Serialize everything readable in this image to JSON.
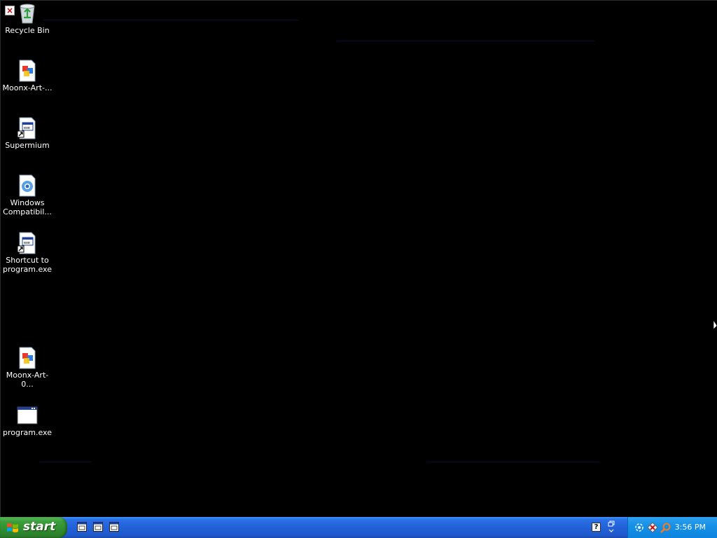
{
  "desktop": {
    "icons": [
      {
        "label": "Recycle Bin",
        "icon": "recycle-bin-icon"
      },
      {
        "label": "Moonx-Art-...",
        "icon": "image-file-icon"
      },
      {
        "label": "Supermium",
        "icon": "program-shortcut-icon"
      },
      {
        "label": "Windows Compatibil...",
        "icon": "compatibility-icon"
      },
      {
        "label": "Shortcut to program.exe",
        "icon": "program-shortcut-icon"
      },
      {
        "label": "Moonx-Art-0...",
        "icon": "image-file-icon"
      },
      {
        "label": "program.exe",
        "icon": "application-window-icon"
      }
    ],
    "error_badge": "×"
  },
  "taskbar": {
    "start_label": "start",
    "quick_launch": [
      "application-window-icon",
      "application-window-icon",
      "application-window-icon"
    ],
    "help_glyph": "?",
    "tray_icons": [
      "network-icon",
      "security-alert-icon",
      "search-icon"
    ],
    "clock": "3:56 PM"
  },
  "colors": {
    "desktop_bg": "#000000",
    "taskbar_blue": "#2361d8",
    "start_green": "#3c9f3c",
    "tray_blue": "#1790e6"
  }
}
